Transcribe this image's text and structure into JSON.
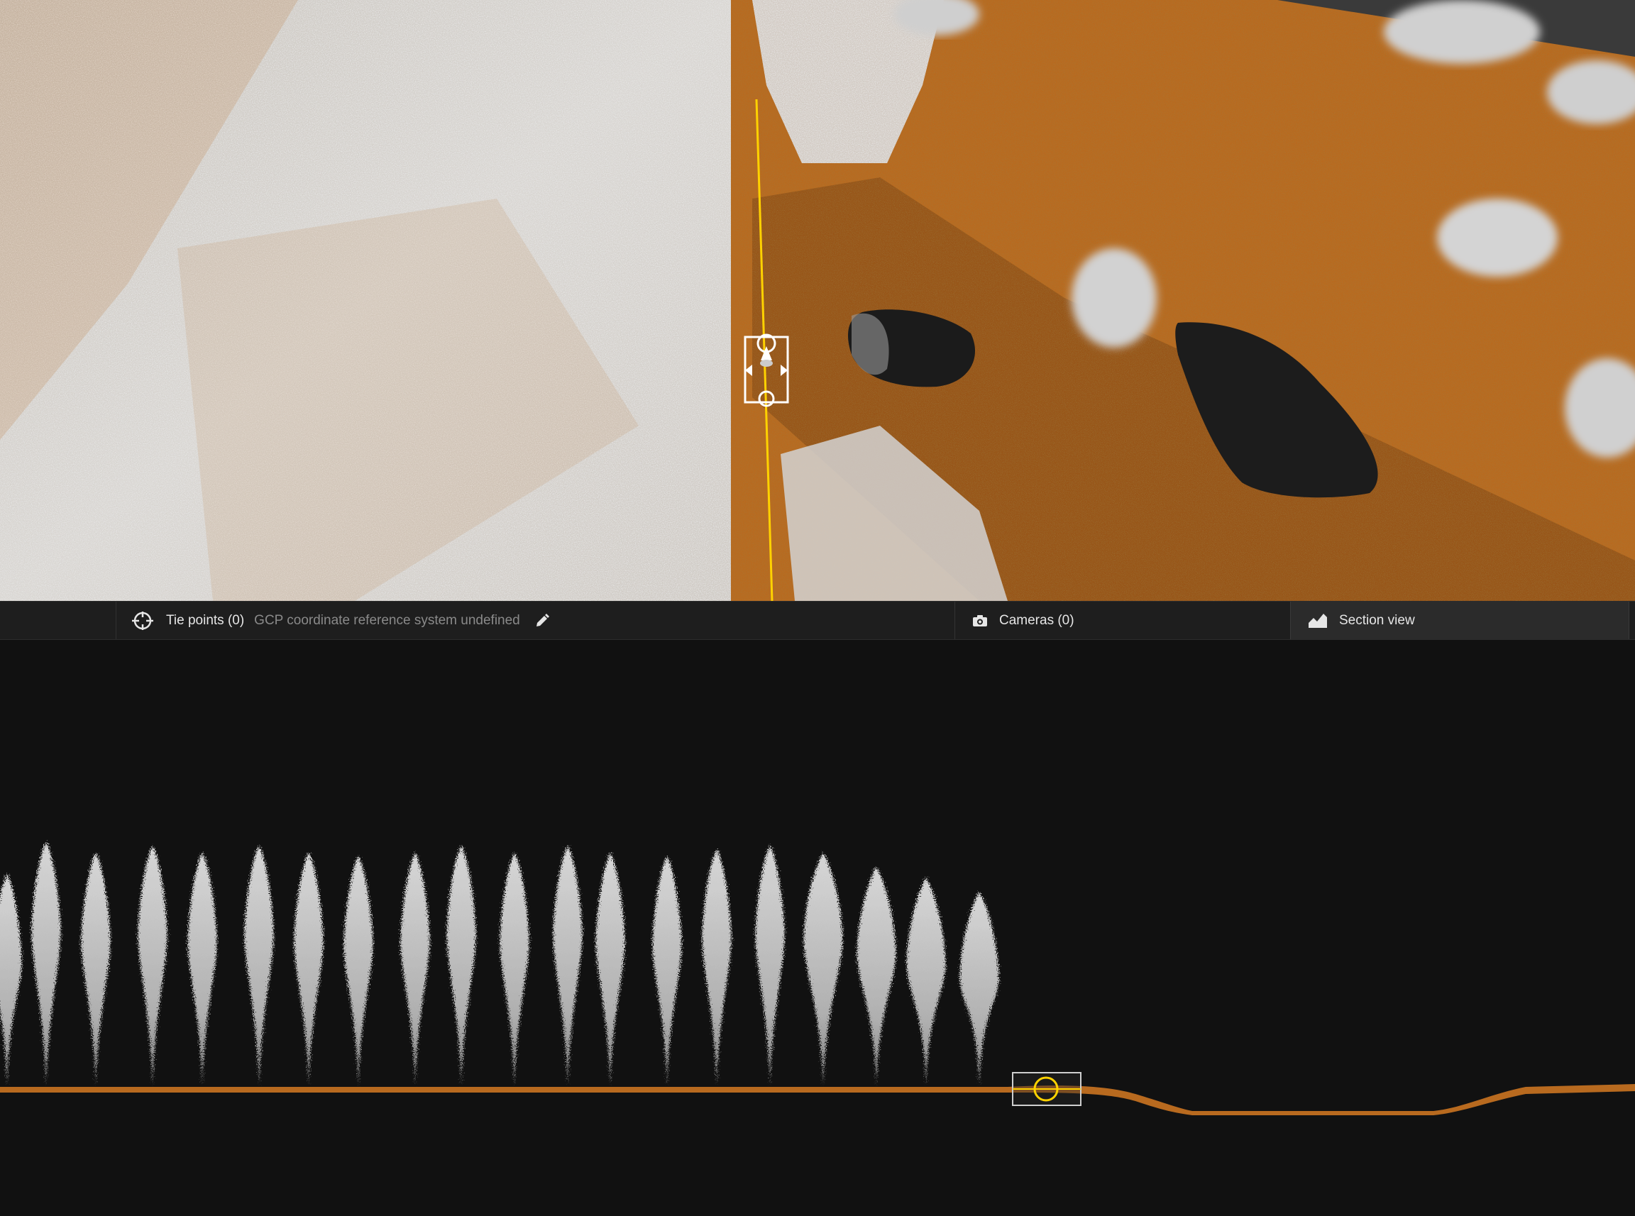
{
  "statusbar": {
    "tie_points_label": "Tie points (0)",
    "gcp_crs_text": "GCP coordinate reference system undefined",
    "cameras_label": "Cameras (0)",
    "section_view_label": "Section view",
    "icons": {
      "tie_points": "crosshair-target-icon",
      "edit": "pencil-icon",
      "cameras": "camera-icon",
      "section_view": "terrain-profile-icon"
    }
  },
  "colors": {
    "ground": "#b86a1f",
    "trees": "#d8d8d8",
    "section_line": "#ffd200",
    "background_dark": "#111111",
    "statusbar": "#1e1e1e",
    "active_tab": "#2b2b2b"
  }
}
